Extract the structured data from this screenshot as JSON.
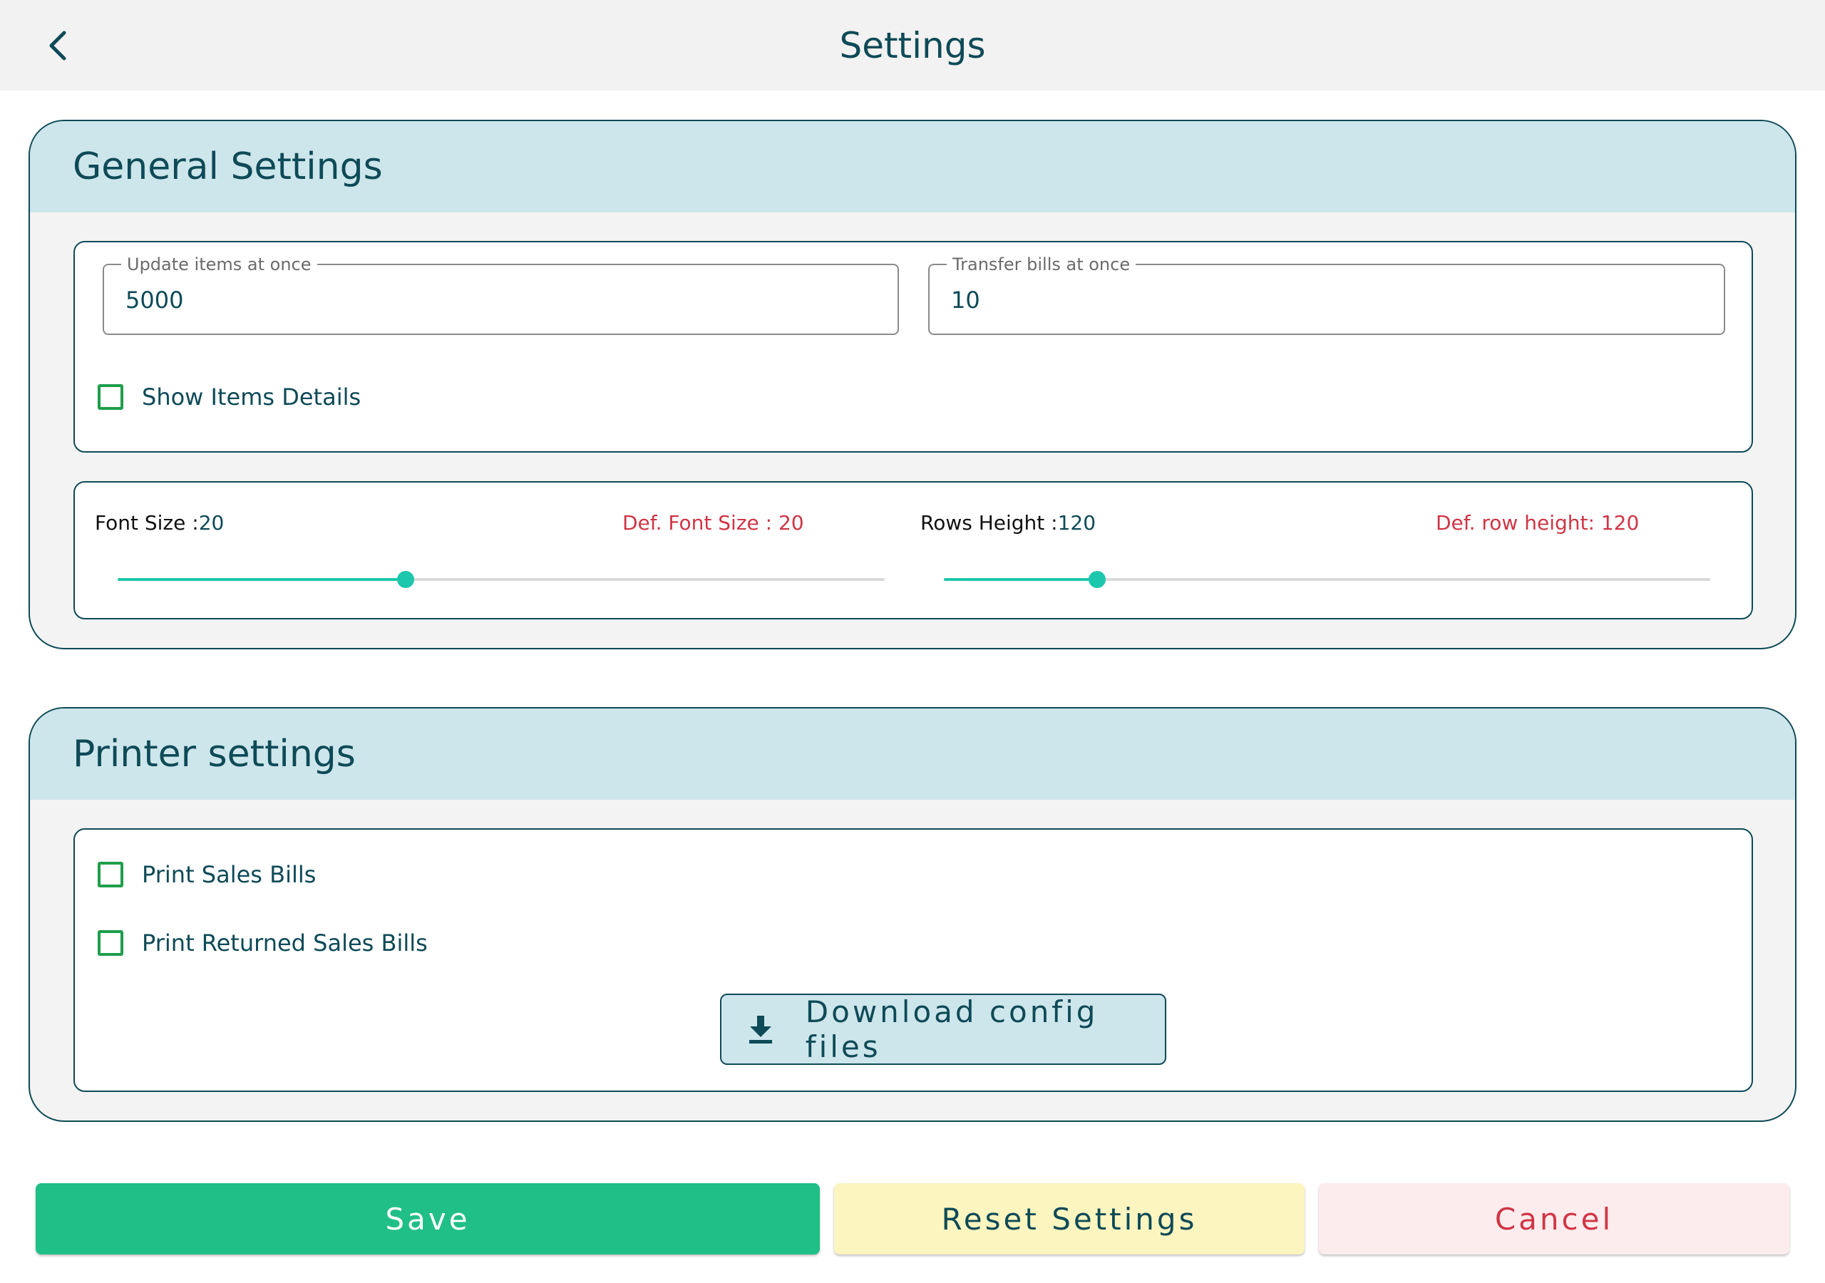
{
  "header": {
    "title": "Settings"
  },
  "general": {
    "title": "General Settings",
    "update_items": {
      "label": "Update items at once",
      "value": "5000"
    },
    "transfer_bills": {
      "label": "Transfer bills at once",
      "value": "10"
    },
    "show_items_details": {
      "label": "Show Items Details",
      "checked": false
    },
    "font_size": {
      "label": "Font Size :",
      "value": "20",
      "default_label": "Def. Font Size : 20",
      "fill_fraction": 0.375
    },
    "rows_height": {
      "label": "Rows Height :",
      "value": "120",
      "default_label": "Def. row height: 120",
      "fill_fraction": 0.2
    }
  },
  "printer": {
    "title": "Printer settings",
    "print_sales_bills": {
      "label": "Print Sales Bills",
      "checked": false
    },
    "print_returned_sales_bills": {
      "label": "Print Returned Sales Bills",
      "checked": false
    },
    "download_label": "Download config files"
  },
  "footer": {
    "save_label": "Save",
    "reset_label": "Reset Settings",
    "cancel_label": "Cancel"
  },
  "icons": {
    "back": "chevron-left-icon",
    "download": "download-icon"
  },
  "colors": {
    "primary": "#0e4a57",
    "accent": "#1cc7ad",
    "save": "#1fbf87",
    "reset": "#fdf5c0",
    "cancel": "#fdeced",
    "danger": "#d03545",
    "checkbox": "#1f9e4b",
    "header_band": "#cde6eb"
  }
}
